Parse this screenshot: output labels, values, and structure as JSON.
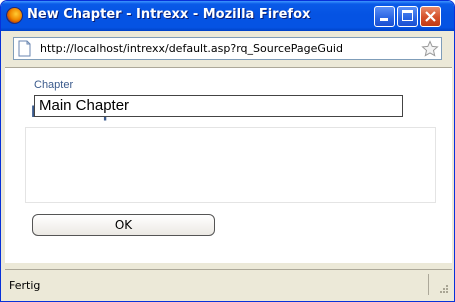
{
  "window": {
    "title": "New Chapter - Intrexx - Mozilla Firefox",
    "titlebar_color": "#0553e3"
  },
  "urlbar": {
    "url": "http://localhost/intrexx/default.asp?rq_SourcePageGuid",
    "page_icon": "page-icon",
    "bookmark_icon": "star-icon"
  },
  "dialog": {
    "title": "New Chapter",
    "title_color": "#3a5a8c",
    "field": {
      "label": "Chapter",
      "value": "Main Chapter"
    },
    "ok_label": "OK"
  },
  "statusbar": {
    "text": "Fertig"
  }
}
